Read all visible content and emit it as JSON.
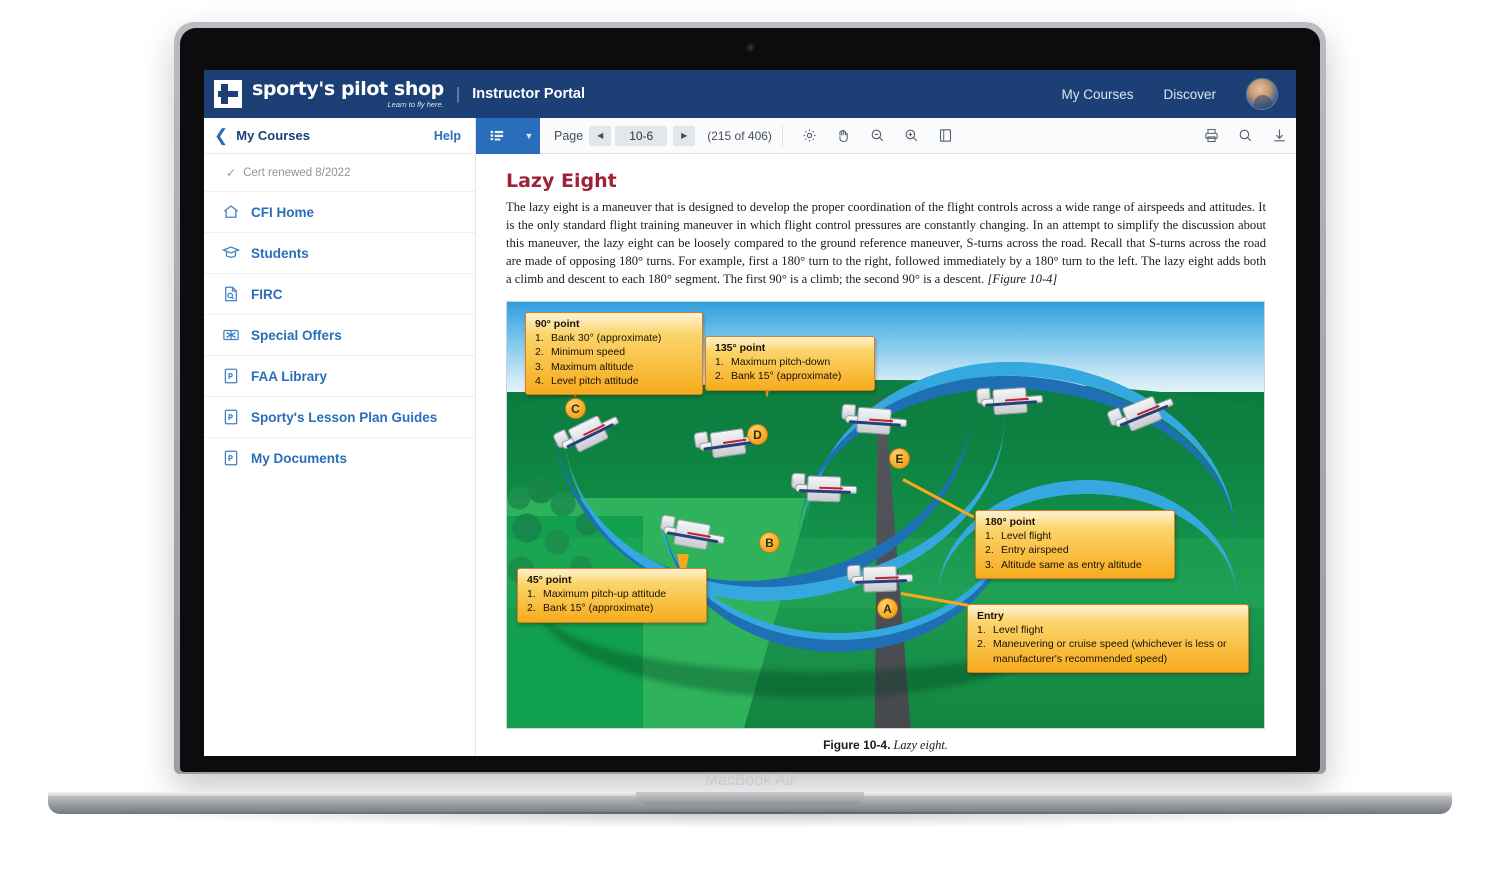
{
  "device": {
    "label": "MacBook Air"
  },
  "topnav": {
    "brand_name": "sporty's pilot shop",
    "brand_tagline": "Learn to fly here.",
    "divider": "|",
    "portal_title": "Instructor Portal",
    "links": [
      {
        "label": "My Courses"
      },
      {
        "label": "Discover"
      }
    ]
  },
  "sidebar": {
    "back_label": "My Courses",
    "help_label": "Help",
    "cert_status": "Cert renewed 8/2022",
    "items": [
      {
        "label": "CFI Home",
        "icon": "home-icon"
      },
      {
        "label": "Students",
        "icon": "graduation-cap-icon"
      },
      {
        "label": "FIRC",
        "icon": "document-search-icon"
      },
      {
        "label": "Special Offers",
        "icon": "gift-ticket-icon"
      },
      {
        "label": "FAA Library",
        "icon": "pdf-file-icon"
      },
      {
        "label": "Sporty's Lesson Plan Guides",
        "icon": "pdf-file-icon"
      },
      {
        "label": "My Documents",
        "icon": "pdf-file-icon"
      }
    ]
  },
  "toolbar": {
    "sidebar_toggle_icon": "list-view-icon",
    "caret_icon": "chevron-down-icon",
    "page_label": "Page",
    "prev_icon": "triangle-left-icon",
    "next_icon": "triangle-right-icon",
    "page_value": "10-6",
    "page_count": "(215 of 406)",
    "tools": [
      {
        "name": "settings-icon"
      },
      {
        "name": "pan-hand-icon"
      },
      {
        "name": "zoom-out-icon"
      },
      {
        "name": "zoom-in-icon"
      },
      {
        "name": "page-layout-icon"
      }
    ],
    "right_tools": [
      {
        "name": "print-icon"
      },
      {
        "name": "search-icon"
      },
      {
        "name": "download-icon"
      }
    ]
  },
  "document": {
    "heading": "Lazy Eight",
    "body": "The lazy eight is a maneuver that is designed to develop the proper coordination of the flight controls across a wide range of airspeeds and attitudes. It is the only standard flight training maneuver in which flight control pressures are constantly changing. In an attempt to simplify the discussion about this maneuver, the lazy eight can be loosely compared to the ground reference maneuver, S-turns across the road. Recall that S-turns across the road are made of opposing 180° turns. For example, first a 180° turn to the right, followed immediately by a 180° turn to the left. The lazy eight adds both a climb and descent to each 180° segment. The first 90° is a climb; the second 90° is a descent.",
    "body_reference": "[Figure 10-4]",
    "figure": {
      "caption_label": "Figure 10-4.",
      "caption_text": "Lazy eight.",
      "markers": [
        "A",
        "B",
        "C",
        "D",
        "E"
      ],
      "callouts": [
        {
          "title": "90° point",
          "items": [
            "Bank 30° (approximate)",
            "Minimum speed",
            "Maximum altitude",
            "Level pitch attitude"
          ]
        },
        {
          "title": "135° point",
          "items": [
            "Maximum pitch-down",
            "Bank 15° (approximate)"
          ]
        },
        {
          "title": "45° point",
          "items": [
            "Maximum pitch-up attitude",
            "Bank 15° (approximate)"
          ]
        },
        {
          "title": "180° point",
          "items": [
            "Level flight",
            "Entry airspeed",
            "Altitude same as entry altitude"
          ]
        },
        {
          "title": "Entry",
          "items": [
            "Level flight",
            "Maneuvering or cruise speed (whichever is less or manufacturer's recommended speed)"
          ]
        }
      ]
    }
  },
  "colors": {
    "brand_navy": "#1c4075",
    "link_blue": "#2a6ebb",
    "heading_red": "#9d2235",
    "callout_orange": "#f7a81c"
  }
}
